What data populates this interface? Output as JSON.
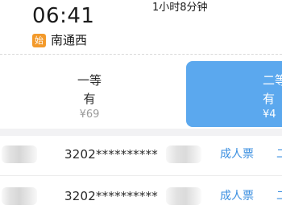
{
  "journey": {
    "departure_time": "06:41",
    "duration": "1小时8分钟",
    "origin_badge": "始",
    "origin_station": "南通西"
  },
  "seats": [
    {
      "name": "一等",
      "availability": "有",
      "price": "¥69",
      "selected": false
    },
    {
      "name": "二等",
      "availability": "有",
      "price": "¥4",
      "selected": true
    }
  ],
  "passengers": [
    {
      "id_number": "3202**********",
      "ticket_type": "成人票",
      "more_label": "二"
    },
    {
      "id_number": "3202**********",
      "ticket_type": "成人票",
      "more_label": "二"
    }
  ],
  "colors": {
    "accent_blue": "#5ba8ee",
    "link_blue": "#3b8fe0",
    "origin_badge": "#f39a2b"
  }
}
